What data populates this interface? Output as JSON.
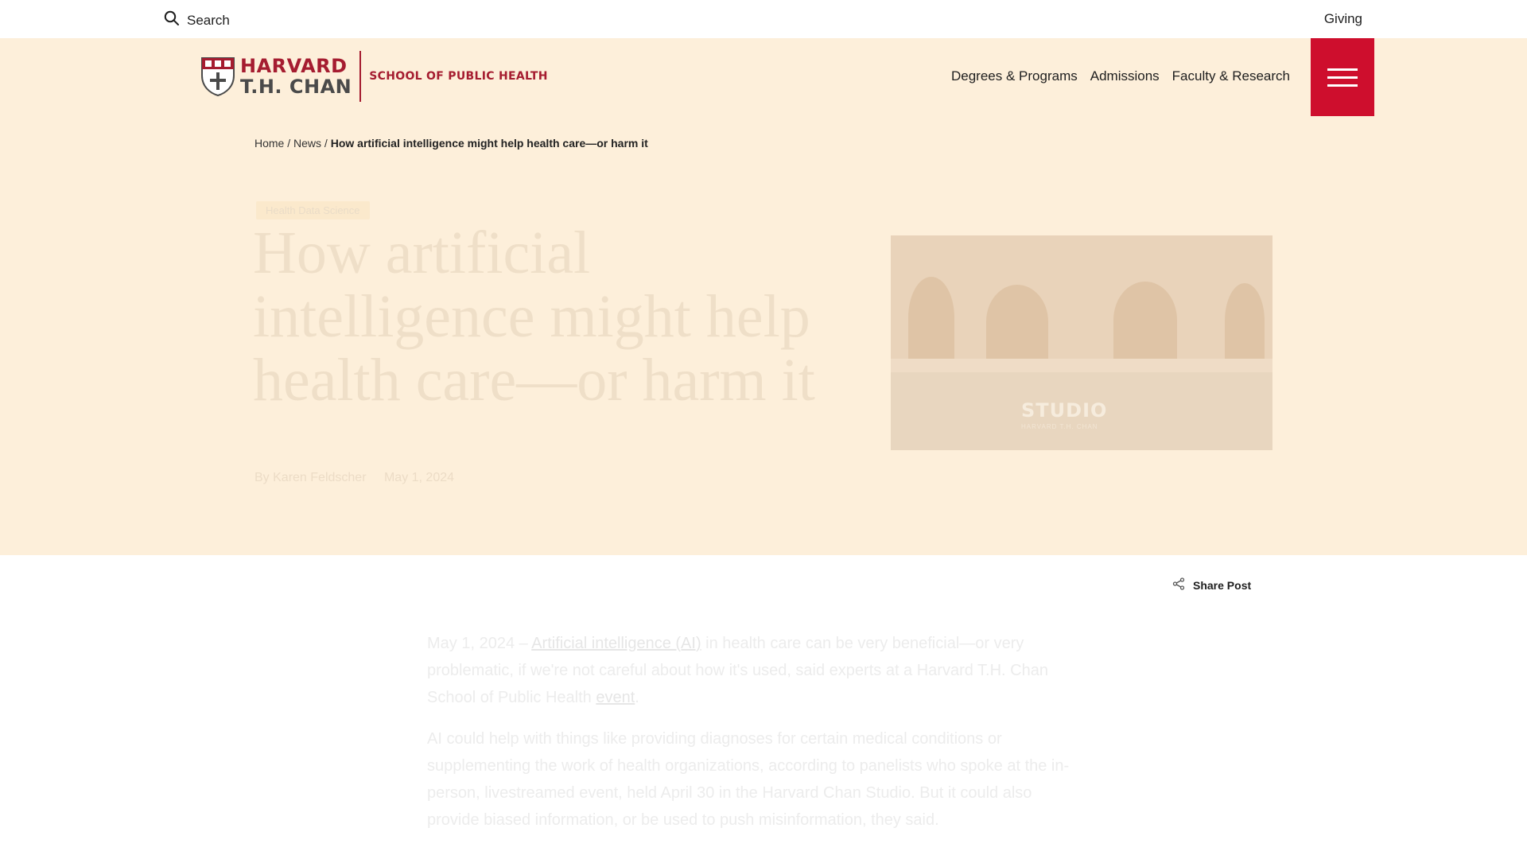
{
  "utility": {
    "search_label": "Search",
    "giving_label": "Giving"
  },
  "logo": {
    "line1": "HARVARD",
    "line2": "T.H. CHAN",
    "school": "SCHOOL OF PUBLIC HEALTH"
  },
  "nav": {
    "items": [
      {
        "label": "Degrees & Programs"
      },
      {
        "label": "Admissions"
      },
      {
        "label": "Faculty & Research"
      }
    ]
  },
  "breadcrumb": {
    "home": "Home",
    "sep1": " / ",
    "news": "News",
    "sep2": " / ",
    "current": "How artificial intelligence might help health care—or harm it"
  },
  "hero": {
    "tag": "Health Data Science",
    "title": "How artificial intelligence might help health care—or harm it",
    "image_text": "STUDIO",
    "image_subtext": "HARVARD T.H. CHAN",
    "byline_prefix": "By ",
    "author": "Karen Feldscher",
    "date": "May 1, 2024"
  },
  "share": {
    "label": "Share Post"
  },
  "article": {
    "p1_dateline": "May 1, 2024 – ",
    "p1_link": "Artificial intelligence (AI)",
    "p1_mid": " in health care can be very beneficial—or very problematic, if we're not careful about how it's used, said experts at a Harvard T.H. Chan School of Public Health ",
    "p1_link2": "event",
    "p1_end": ".",
    "p2": "AI could help with things like providing diagnoses for certain medical conditions or supplementing the work of health organizations, according to panelists who spoke at the in-person, livestreamed event, held April 30 in the Harvard Chan Studio. But it could also provide biased information, or be used to push misinformation, they said."
  },
  "colors": {
    "accent": "#ce0e2d",
    "brand_crimson": "#a51c30",
    "hero_bg": "#fdefda"
  }
}
